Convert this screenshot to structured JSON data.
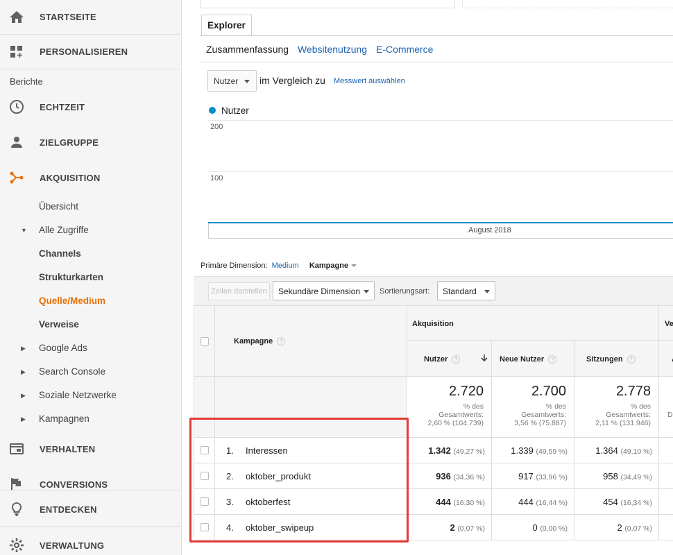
{
  "sidebar": {
    "top_items": [
      {
        "label": "STARTSEITE",
        "icon": "home-icon"
      },
      {
        "label": "PERSONALISIEREN",
        "icon": "dashboard-icon"
      }
    ],
    "reports_label": "Berichte",
    "main_items": [
      {
        "label": "ECHTZEIT",
        "icon": "clock-icon"
      },
      {
        "label": "ZIELGRUPPE",
        "icon": "person-icon"
      },
      {
        "label": "AKQUISITION",
        "icon": "acquisition-icon"
      }
    ],
    "acquisition_sub": {
      "overview": "Übersicht",
      "all_traffic": "Alle Zugriffe",
      "channels": "Channels",
      "treemaps": "Strukturkarten",
      "source_medium": "Quelle/Medium",
      "referrals": "Verweise",
      "google_ads": "Google Ads",
      "search_console": "Search Console",
      "social": "Soziale Netzwerke",
      "campaigns": "Kampagnen"
    },
    "bottom_items": [
      {
        "label": "VERHALTEN",
        "icon": "behavior-icon"
      },
      {
        "label": "CONVERSIONS",
        "icon": "flag-icon"
      },
      {
        "label": "ENTDECKEN",
        "icon": "lightbulb-icon"
      },
      {
        "label": "VERWALTUNG",
        "icon": "gear-icon"
      }
    ],
    "accent_color": "#e8710a"
  },
  "explorer": {
    "tab_label": "Explorer",
    "subtabs": [
      "Zusammenfassung",
      "Websitenutzung",
      "E-Commerce"
    ],
    "metric_select": "Nutzer",
    "compare_text": "im Vergleich zu",
    "select_metric_link": "Messwert auswählen"
  },
  "chart_data": {
    "type": "line",
    "series": [
      {
        "name": "Nutzer",
        "color": "#058dc7"
      }
    ],
    "y_ticks": [
      "200",
      "100"
    ],
    "x_label": "August 2018"
  },
  "dimension": {
    "label": "Primäre Dimension:",
    "medium": "Medium",
    "campaign": "Kampagne"
  },
  "toolbar": {
    "plot_rows": "Zeilen darstellen",
    "secondary_dimension": "Sekundäre Dimension",
    "sort_label": "Sortierungsart:",
    "sort_value": "Standard"
  },
  "table": {
    "col_campaign": "Kampagne",
    "group_acquisition": "Akquisition",
    "group_behavior": "Ve",
    "col_users": "Nutzer",
    "col_new_users": "Neue Nutzer",
    "col_sessions": "Sitzungen",
    "col_next": "A",
    "totals": {
      "users": {
        "value": "2.720",
        "l1": "% des",
        "l2": "Gesamtwerts:",
        "l3": "2,60 % (104.739)"
      },
      "new_users": {
        "value": "2.700",
        "l1": "% des",
        "l2": "Gesamtwerts:",
        "l3": "3,56 % (75.887)"
      },
      "sessions": {
        "value": "2.778",
        "l1": "% des",
        "l2": "Gesamtwerts:",
        "l3": "2,11 % (131.946)"
      },
      "next_partial": "D"
    },
    "rows": [
      {
        "num": "1.",
        "name": "Interessen",
        "users": "1.342",
        "users_pct": "(49,27 %)",
        "new_users": "1.339",
        "new_users_pct": "(49,59 %)",
        "sessions": "1.364",
        "sessions_pct": "(49,10 %)"
      },
      {
        "num": "2.",
        "name": "oktober_produkt",
        "users": "936",
        "users_pct": "(34,36 %)",
        "new_users": "917",
        "new_users_pct": "(33,96 %)",
        "sessions": "958",
        "sessions_pct": "(34,49 %)"
      },
      {
        "num": "3.",
        "name": "oktoberfest",
        "users": "444",
        "users_pct": "(16,30 %)",
        "new_users": "444",
        "new_users_pct": "(16,44 %)",
        "sessions": "454",
        "sessions_pct": "(16,34 %)"
      },
      {
        "num": "4.",
        "name": "oktober_swipeup",
        "users": "2",
        "users_pct": "(0,07 %)",
        "new_users": "0",
        "new_users_pct": "(0,00 %)",
        "sessions": "2",
        "sessions_pct": "(0,07 %)"
      }
    ]
  },
  "highlight_color": "#e53935"
}
